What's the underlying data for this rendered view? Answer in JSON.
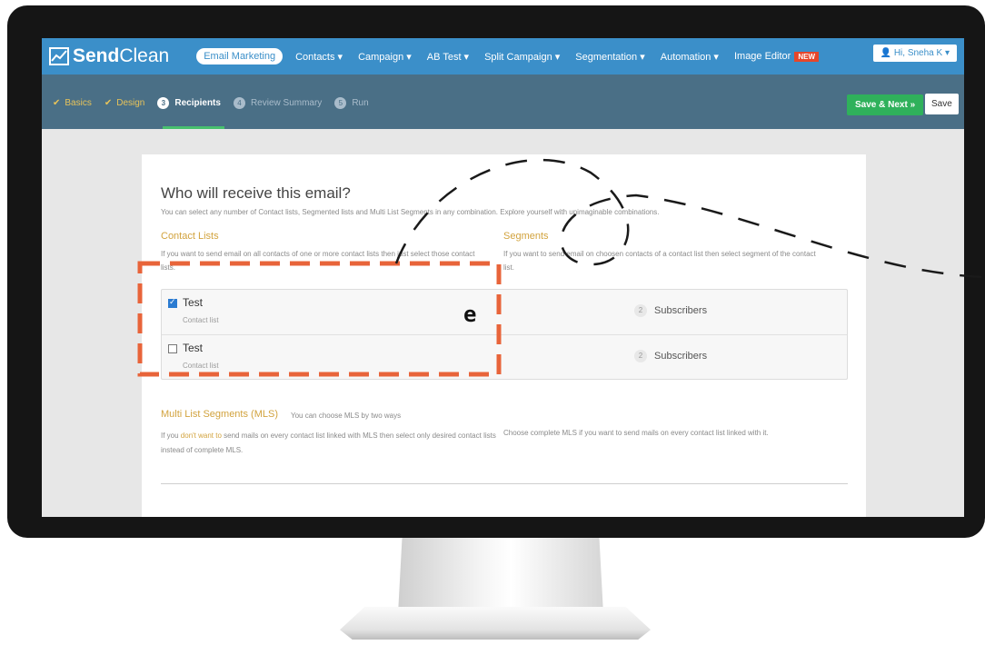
{
  "brand": {
    "name_bold": "Send",
    "name_rest": "Clean"
  },
  "nav": {
    "items": [
      {
        "label": "Email Marketing",
        "active": true
      },
      {
        "label": "Contacts ▾"
      },
      {
        "label": "Campaign ▾"
      },
      {
        "label": "AB Test ▾"
      },
      {
        "label": "Split Campaign ▾"
      },
      {
        "label": "Segmentation ▾"
      },
      {
        "label": "Automation ▾"
      },
      {
        "label": "Image Editor"
      }
    ],
    "new_badge": "NEW",
    "user": "Hi, Sneha K ▾"
  },
  "steps": [
    {
      "label": "Basics",
      "state": "done"
    },
    {
      "label": "Design",
      "state": "done"
    },
    {
      "num": "3",
      "label": "Recipients",
      "state": "active"
    },
    {
      "num": "4",
      "label": "Review Summary",
      "state": "pending"
    },
    {
      "num": "5",
      "label": "Run",
      "state": "pending"
    }
  ],
  "actions": {
    "save_next": "Save & Next »",
    "save": "Save"
  },
  "main": {
    "title": "Who will receive this email?",
    "subtitle": "You can select any number of Contact lists, Segmented lists and Multi List Segments in any combination. Explore yourself with unimaginable combinations.",
    "contact_lists": {
      "title": "Contact Lists",
      "desc": "If you want to send email on all contacts of one or more contact lists then just select those contact lists."
    },
    "segments": {
      "title": "Segments",
      "desc": "If you want to send email on choosen contacts of a contact list then select segment of the contact list."
    },
    "lists": [
      {
        "name": "Test",
        "type": "Contact list",
        "checked": true,
        "count": "2",
        "subs_label": "Subscribers"
      },
      {
        "name": "Test",
        "type": "Contact list",
        "checked": false,
        "count": "2",
        "subs_label": "Subscribers"
      }
    ],
    "mls": {
      "title": "Multi List Segments (MLS)",
      "note": "You can choose MLS by two ways",
      "left_pre": "If you ",
      "left_hl": "don't want to",
      "left_post": " send mails on every contact list linked with MLS then select only desired contact lists instead of complete MLS.",
      "right": "Choose complete MLS if you want to send mails on every contact list linked with it."
    }
  },
  "annotation": {
    "marker": "e",
    "color": "#e8643a"
  }
}
